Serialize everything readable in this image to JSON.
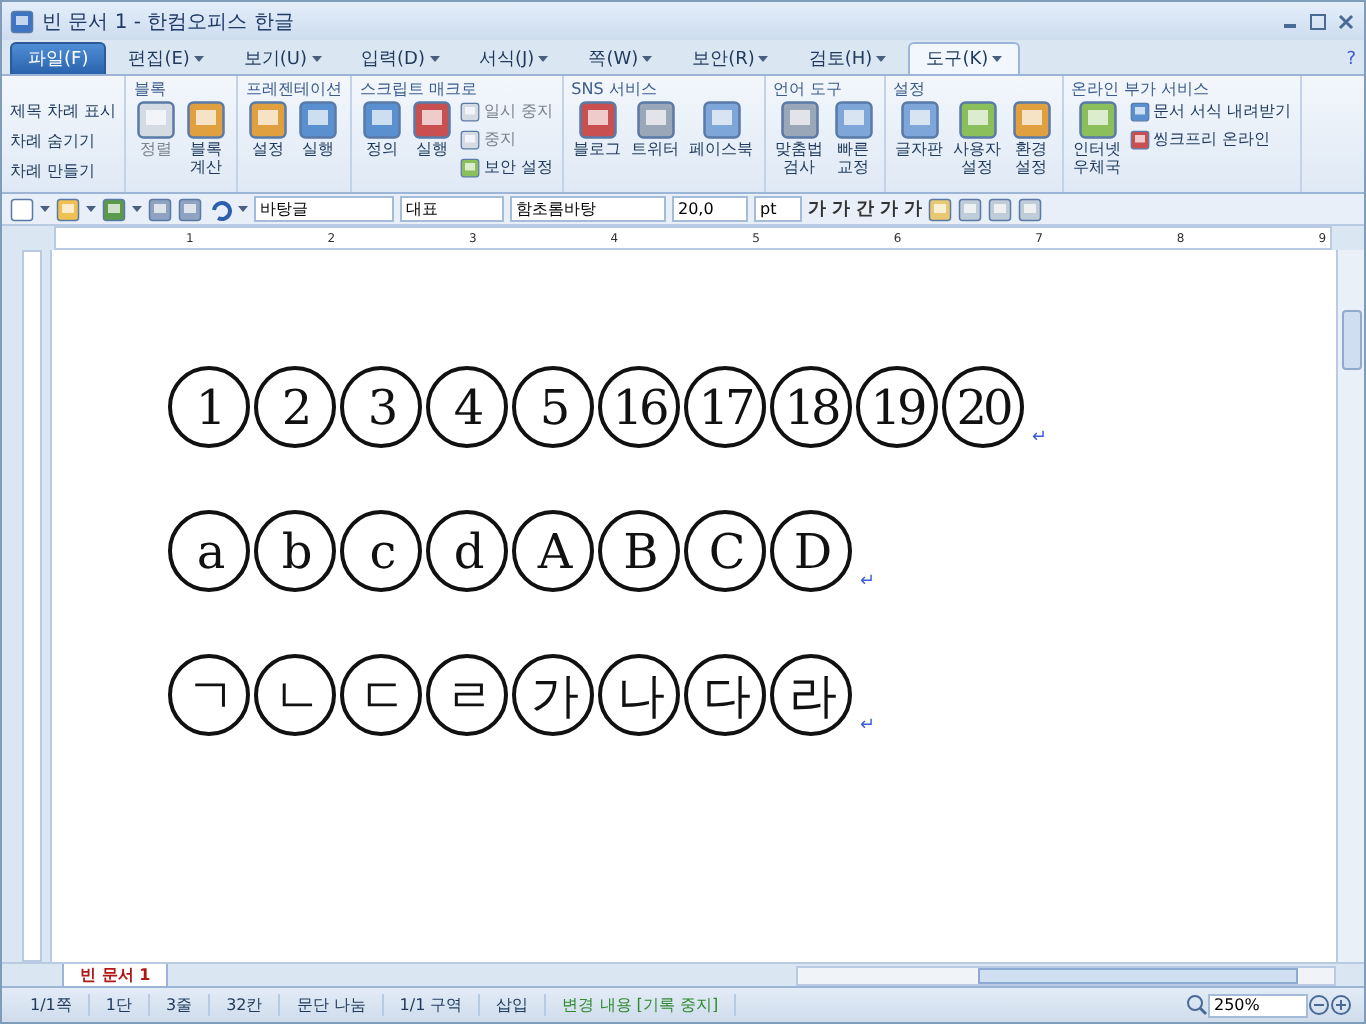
{
  "window": {
    "title": "빈 문서 1 - 한컴오피스 한글"
  },
  "menu_tabs": [
    {
      "label": "파일(F)",
      "kind": "file",
      "selected": false,
      "dropdown": false
    },
    {
      "label": "편집(E)",
      "kind": "tab",
      "selected": false,
      "dropdown": true
    },
    {
      "label": "보기(U)",
      "kind": "tab",
      "selected": false,
      "dropdown": true
    },
    {
      "label": "입력(D)",
      "kind": "tab",
      "selected": false,
      "dropdown": true
    },
    {
      "label": "서식(J)",
      "kind": "tab",
      "selected": false,
      "dropdown": true
    },
    {
      "label": "쪽(W)",
      "kind": "tab",
      "selected": false,
      "dropdown": true
    },
    {
      "label": "보안(R)",
      "kind": "tab",
      "selected": false,
      "dropdown": true
    },
    {
      "label": "검토(H)",
      "kind": "tab",
      "selected": false,
      "dropdown": true
    },
    {
      "label": "도구(K)",
      "kind": "tab",
      "selected": true,
      "dropdown": true
    }
  ],
  "ribbon_help": "?",
  "ribbon_groups": [
    {
      "items": [
        {
          "label": "제목 차례 표시",
          "kind": "text"
        },
        {
          "label": "차례 숨기기",
          "kind": "text"
        },
        {
          "label": "차례 만들기",
          "kind": "text"
        }
      ]
    },
    {
      "title": "블록",
      "items": [
        {
          "label": "정렬",
          "kind": "large",
          "disabled": true
        },
        {
          "label": "블록\n계산",
          "kind": "large",
          "disabled": false
        }
      ]
    },
    {
      "title": "프레젠테이션",
      "items": [
        {
          "label": "설정",
          "kind": "large",
          "disabled": false
        },
        {
          "label": "실행",
          "kind": "large",
          "disabled": false
        }
      ]
    },
    {
      "title": "스크립트 매크로",
      "items": [
        {
          "label": "정의",
          "kind": "large",
          "disabled": false
        },
        {
          "label": "실행",
          "kind": "large",
          "disabled": false
        },
        {
          "label": "일시 중지",
          "kind": "small",
          "disabled": true
        },
        {
          "label": "중지",
          "kind": "small",
          "disabled": true
        },
        {
          "label": "보안 설정",
          "kind": "small",
          "disabled": false
        }
      ]
    },
    {
      "title": "SNS 서비스",
      "items": [
        {
          "label": "블로그",
          "kind": "large",
          "disabled": false
        },
        {
          "label": "트위터",
          "kind": "large",
          "disabled": false
        },
        {
          "label": "페이스북",
          "kind": "large",
          "disabled": false
        }
      ]
    },
    {
      "title": "언어 도구",
      "items": [
        {
          "label": "맞춤법\n검사",
          "kind": "large",
          "disabled": false
        },
        {
          "label": "빠른\n교정",
          "kind": "large",
          "disabled": false
        }
      ]
    },
    {
      "title": "설정",
      "items": [
        {
          "label": "글자판",
          "kind": "large",
          "disabled": false
        },
        {
          "label": "사용자\n설정",
          "kind": "large",
          "disabled": false
        },
        {
          "label": "환경\n설정",
          "kind": "large",
          "disabled": false
        }
      ]
    },
    {
      "title": "온라인 부가 서비스",
      "items": [
        {
          "label": "인터넷\n우체국",
          "kind": "large",
          "disabled": false
        },
        {
          "label": "문서 서식 내려받기",
          "kind": "small",
          "disabled": false
        },
        {
          "label": "씽크프리 온라인",
          "kind": "small",
          "disabled": false
        }
      ]
    }
  ],
  "toolbar": {
    "style": "바탕글",
    "language": "대표",
    "font": "함초롬바탕",
    "size": "20,0",
    "unit": "pt",
    "formats": [
      "가",
      "가",
      "간",
      "가",
      "가"
    ]
  },
  "ruler": {
    "labels": [
      "1",
      "2",
      "3",
      "4",
      "5",
      "6",
      "7",
      "8",
      "9"
    ]
  },
  "document": {
    "lines": [
      {
        "chars": [
          "1",
          "2",
          "3",
          "4",
          "5",
          "16",
          "17",
          "18",
          "19",
          "20"
        ],
        "mark": "↵"
      },
      {
        "chars": [
          "a",
          "b",
          "c",
          "d",
          "A",
          "B",
          "C",
          "D"
        ],
        "mark": "↵"
      },
      {
        "chars": [
          "ㄱ",
          "ㄴ",
          "ㄷ",
          "ㄹ",
          "가",
          "나",
          "다",
          "라"
        ],
        "mark": "↵"
      }
    ]
  },
  "doc_tabs": [
    {
      "label": "빈 문서 1",
      "selected": true
    }
  ],
  "status_bar": {
    "items": [
      {
        "label": "1/1쪽",
        "kind": "plain"
      },
      {
        "label": "1단",
        "kind": "plain"
      },
      {
        "label": "3줄",
        "kind": "plain"
      },
      {
        "label": "32칸",
        "kind": "plain"
      },
      {
        "label": "문단 나눔",
        "kind": "plain"
      },
      {
        "label": "1/1 구역",
        "kind": "plain"
      },
      {
        "label": "삽입",
        "kind": "plain"
      },
      {
        "label": "변경 내용 [기록 중지]",
        "kind": "track"
      }
    ],
    "zoom": "250%"
  }
}
